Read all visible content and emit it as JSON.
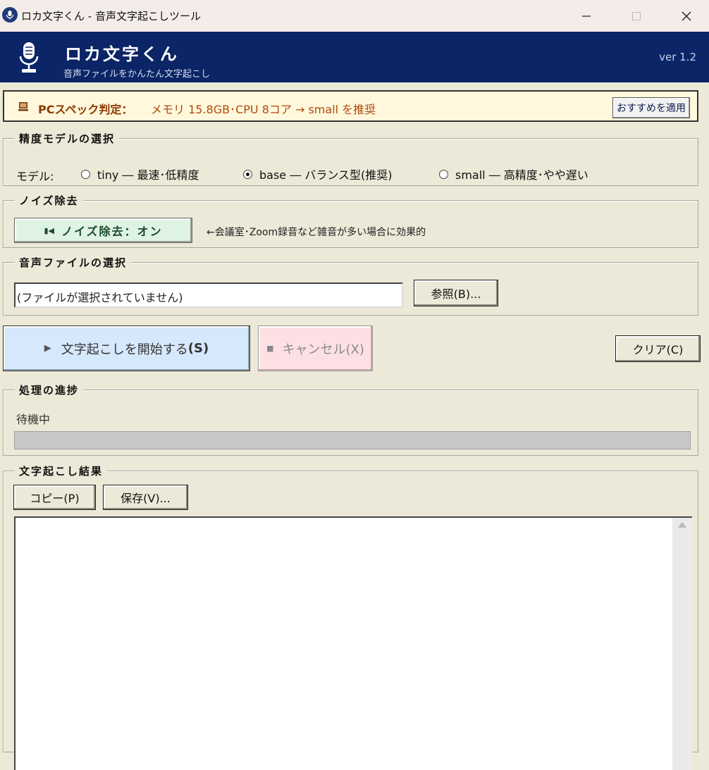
{
  "window": {
    "title": "ロカ文字くん - 音声文字起こしツール",
    "minimize_icon": "minimize-icon",
    "maximize_icon": "maximize-icon",
    "close_icon": "close-icon"
  },
  "header": {
    "app_name": "ロカ文字くん",
    "subtitle": "音声ファイルをかんたん文字起こし",
    "version": "ver 1.2",
    "background": "#0b2566"
  },
  "spec": {
    "label": "PCスペック判定：",
    "value": "メモリ 15.8GB･CPU 8コア → small を推奨",
    "apply_button": "おすすめを適用",
    "background": "#fff8dc"
  },
  "model": {
    "group_title": "精度モデルの選択",
    "label": "モデル:",
    "options": [
      {
        "label": "tiny ― 最速･低精度",
        "selected": false
      },
      {
        "label": "base ― バランス型(推奨)",
        "selected": true
      },
      {
        "label": "small ― 高精度･やや遅い",
        "selected": false
      }
    ]
  },
  "noise": {
    "group_title": "ノイズ除去",
    "button_icon": "speaker-icon",
    "button_label": "ノイズ除去：オン",
    "hint": "←会議室･Zoom録音など雑音が多い場合に効果的",
    "background": "#dff3e4"
  },
  "file": {
    "group_title": "音声ファイルの選択",
    "placeholder": "(ファイルが選択されていません)",
    "browse_button": "参照(B)..."
  },
  "actions": {
    "start_label": "文字起こしを開始する",
    "start_shortcut": "(S)",
    "cancel_label": "キャンセル(X)",
    "clear_label": "クリア(C)",
    "start_color": "#d6e8fb",
    "cancel_color": "#fde0e4"
  },
  "progress": {
    "group_title": "処理の進捗",
    "status": "待機中",
    "value": 0
  },
  "result": {
    "group_title": "文字起こし結果",
    "copy_button": "コピー(P)",
    "save_button": "保存(V)...",
    "text": ""
  }
}
